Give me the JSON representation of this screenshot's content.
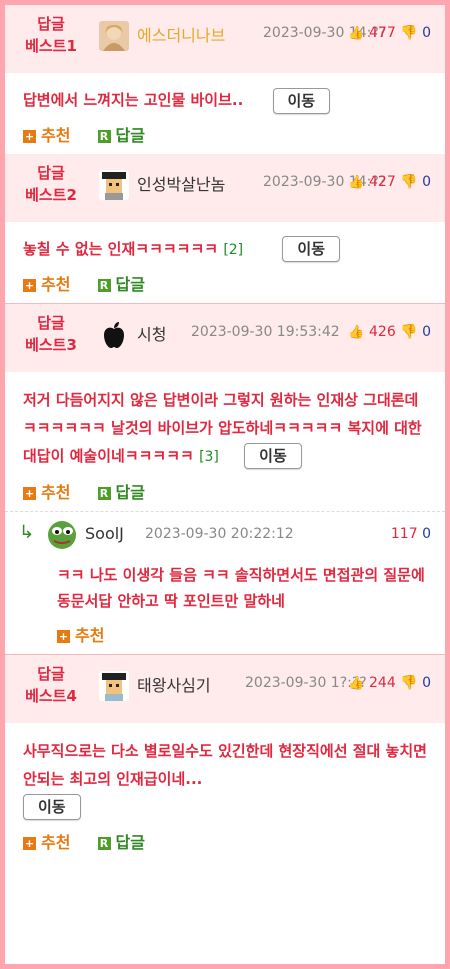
{
  "colors": {
    "accent": "#e1283f",
    "head_bg": "#ffeaec",
    "recommend": "#e77b11",
    "reply": "#2f8a22"
  },
  "labels": {
    "move": "이동",
    "recommend": "추천",
    "reply": "답글",
    "up_icon": "thumbs-up-icon",
    "down_icon": "thumbs-down-icon"
  },
  "best": [
    {
      "label_top": "답글",
      "label_bottom": "베스트1",
      "nick": "에스더니나브",
      "date": "2023-09-30 14:??",
      "up": "477",
      "down": "0",
      "content": "답변에서 느껴지는 고인물 바이브..",
      "reply_count": ""
    },
    {
      "label_top": "답글",
      "label_bottom": "베스트2",
      "nick": "인성박살난놈",
      "date": "2023-09-30 14:??",
      "up": "427",
      "down": "0",
      "content": "놓칠 수 없는 인재ㅋㅋㅋㅋㅋㅋ",
      "reply_count": "[2]"
    },
    {
      "label_top": "답글",
      "label_bottom": "베스트3",
      "nick": "시청",
      "date": "2023-09-30 19:53:42",
      "up": "426",
      "down": "0",
      "content": "저거 다듬어지지 않은 답변이라 그렇지 원하는 인재상 그대론데ㅋㅋㅋㅋㅋㅋ 날것의 바이브가 압도하네ㅋㅋㅋㅋㅋ 복지에 대한 대답이 예술이네ㅋㅋㅋㅋㅋ",
      "reply_count": "[3]"
    },
    {
      "label_top": "답글",
      "label_bottom": "베스트4",
      "nick": "태왕사심기",
      "date": "2023-09-30 1?:??",
      "up": "244",
      "down": "0",
      "content": "사무직으로는 다소 별로일수도 있긴한데 현장직에선 절대 놓치면 안되는 최고의 인재급이네...",
      "reply_count": ""
    }
  ],
  "sub_reply": {
    "nick": "SoolJ",
    "date": "2023-09-30 20:22:12",
    "up": "117",
    "down": "0",
    "content": "ㅋㅋ 나도 이생각 들음 ㅋㅋ 솔직하면서도 면접관의 질문에 동문서답 안하고 딱 포인트만 말하네"
  }
}
